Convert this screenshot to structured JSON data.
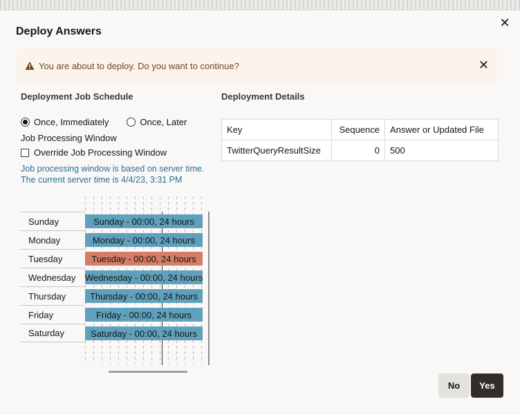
{
  "dialog": {
    "title": "Deploy Answers",
    "close_icon": "close-icon",
    "warning": {
      "text": "You are about to deploy. Do you want to continue?",
      "icon": "warning-triangle-icon",
      "close_icon": "close-icon"
    }
  },
  "schedule": {
    "heading": "Deployment Job Schedule",
    "options": [
      {
        "label": "Once, Immediately",
        "checked": true
      },
      {
        "label": "Once, Later",
        "checked": false
      }
    ],
    "window_heading": "Job Processing Window",
    "override_label": "Override Job Processing Window",
    "override_checked": false,
    "info_line1": "Job processing window is based on server time.",
    "info_line2": "The current server time is 4/4/23, 3:31 PM",
    "days": [
      {
        "day": "Sunday",
        "bar": "Sunday - 00:00, 24 hours",
        "color": "#5fa1bd"
      },
      {
        "day": "Monday",
        "bar": "Monday - 00:00, 24 hours",
        "color": "#5fa1bd"
      },
      {
        "day": "Tuesday",
        "bar": "Tuesday - 00:00, 24 hours",
        "color": "#d47d68"
      },
      {
        "day": "Wednesday",
        "bar": "Wednesday - 00:00, 24 hours",
        "color": "#5fa1bd"
      },
      {
        "day": "Thursday",
        "bar": "Thursday - 00:00, 24 hours",
        "color": "#5fa1bd"
      },
      {
        "day": "Friday",
        "bar": "Friday - 00:00, 24 hours",
        "color": "#5fa1bd"
      },
      {
        "day": "Saturday",
        "bar": "Saturday - 00:00, 24 hours",
        "color": "#5fa1bd"
      }
    ]
  },
  "details": {
    "heading": "Deployment Details",
    "columns": [
      "Key",
      "Sequence",
      "Answer or Updated File"
    ],
    "rows": [
      {
        "key": "TwitterQueryResultSize",
        "sequence": "0",
        "answer": "500"
      }
    ]
  },
  "buttons": {
    "no": "No",
    "yes": "Yes"
  }
}
